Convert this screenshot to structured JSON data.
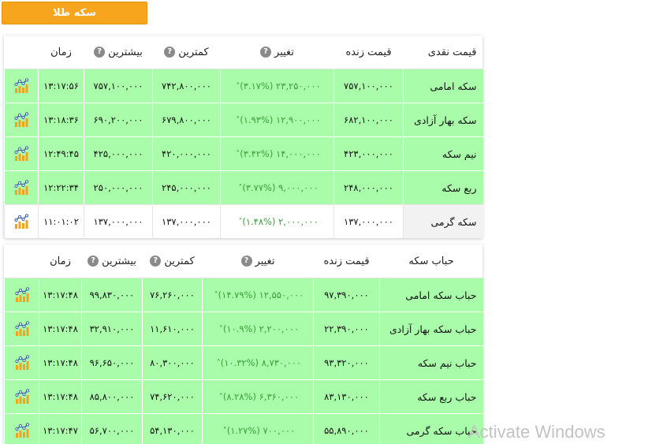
{
  "header": {
    "button_label": "سکه طلا"
  },
  "table1": {
    "headers": {
      "name": "قیمت نقدی",
      "price": "قیمت زنده",
      "change": "تغییر",
      "low": "کمترین",
      "high": "بیشترین",
      "time": "زمان"
    },
    "rows": [
      {
        "name": "سکه امامی",
        "price": "۷۵۷,۱۰۰,۰۰۰",
        "change": "۲۳,۲۵۰,۰۰۰ (۳.۱۷%)",
        "low": "۷۴۲,۸۰۰,۰۰۰",
        "high": "۷۵۷,۱۰۰,۰۰۰",
        "time": "۱۳:۱۷:۵۶"
      },
      {
        "name": "سکه بهار آزادی",
        "price": "۶۸۲,۱۰۰,۰۰۰",
        "change": "۱۲,۹۰۰,۰۰۰ (۱.۹۳%)",
        "low": "۶۷۹,۸۰۰,۰۰۰",
        "high": "۶۹۰,۲۰۰,۰۰۰",
        "time": "۱۳:۱۸:۳۶"
      },
      {
        "name": "نیم سکه",
        "price": "۴۲۳,۰۰۰,۰۰۰",
        "change": "۱۴,۰۰۰,۰۰۰ (۳.۴۲%)",
        "low": "۴۲۰,۰۰۰,۰۰۰",
        "high": "۴۲۵,۰۰۰,۰۰۰",
        "time": "۱۲:۴۹:۴۵"
      },
      {
        "name": "ربع سکه",
        "price": "۲۴۸,۰۰۰,۰۰۰",
        "change": "۹,۰۰۰,۰۰۰ (۳.۷۷%)",
        "low": "۲۴۵,۰۰۰,۰۰۰",
        "high": "۲۵۰,۰۰۰,۰۰۰",
        "time": "۱۲:۲۲:۳۴"
      },
      {
        "name": "سکه گرمی",
        "price": "۱۳۷,۰۰۰,۰۰۰",
        "change": "۲,۰۰۰,۰۰۰ (۱.۴۸%)",
        "low": "۱۳۷,۰۰۰,۰۰۰",
        "high": "۱۳۷,۰۰۰,۰۰۰",
        "time": "۱۱:۰۱:۰۲"
      }
    ]
  },
  "table2": {
    "headers": {
      "name": "حباب سکه",
      "price": "قیمت زنده",
      "change": "تغییر",
      "low": "کمترین",
      "high": "بیشترین",
      "time": "زمان"
    },
    "rows": [
      {
        "name": "حباب سکه امامی",
        "price": "۹۷,۳۹۰,۰۰۰",
        "change": "۱۲,۵۵۰,۰۰۰ (۱۴.۷۹%)",
        "low": "۷۶,۲۶۰,۰۰۰",
        "high": "۹۹,۸۳۰,۰۰۰",
        "time": "۱۳:۱۷:۴۸"
      },
      {
        "name": "حباب سکه بهار آزادی",
        "price": "۲۲,۳۹۰,۰۰۰",
        "change": "۲,۲۰۰,۰۰۰ (۱۰.۹%)",
        "low": "۱۱,۶۱۰,۰۰۰",
        "high": "۳۲,۹۱۰,۰۰۰",
        "time": "۱۳:۱۷:۴۸"
      },
      {
        "name": "حباب نیم سکه",
        "price": "۹۳,۳۲۰,۰۰۰",
        "change": "۸,۷۳۰,۰۰۰ (۱۰.۳۲%)",
        "low": "۸۰,۳۰۰,۰۰۰",
        "high": "۹۶,۶۵۰,۰۰۰",
        "time": "۱۳:۱۷:۴۸"
      },
      {
        "name": "حباب ربع سکه",
        "price": "۸۳,۱۳۰,۰۰۰",
        "change": "۶,۳۶۰,۰۰۰ (۸.۲۸%)",
        "low": "۷۴,۶۲۰,۰۰۰",
        "high": "۸۵,۸۰۰,۰۰۰",
        "time": "۱۳:۱۷:۴۸"
      },
      {
        "name": "حباب سکه گرمی",
        "price": "۵۵,۸۹۰,۰۰۰",
        "change": "۷۰۰,۰۰۰ (۱.۲۷%)",
        "low": "۵۴,۱۳۰,۰۰۰",
        "high": "۵۶,۷۰۰,۰۰۰",
        "time": "۱۳:۱۷:۴۷"
      }
    ]
  },
  "watermark": "Activate Windows",
  "colors": {
    "row_green": "#a9fca9",
    "accent_orange": "#f7a51c",
    "change_green": "#3aa03a"
  },
  "icons": {
    "row_chart": "chart-icon",
    "header_help": "help-icon",
    "change_up": "arrow-up-icon"
  }
}
